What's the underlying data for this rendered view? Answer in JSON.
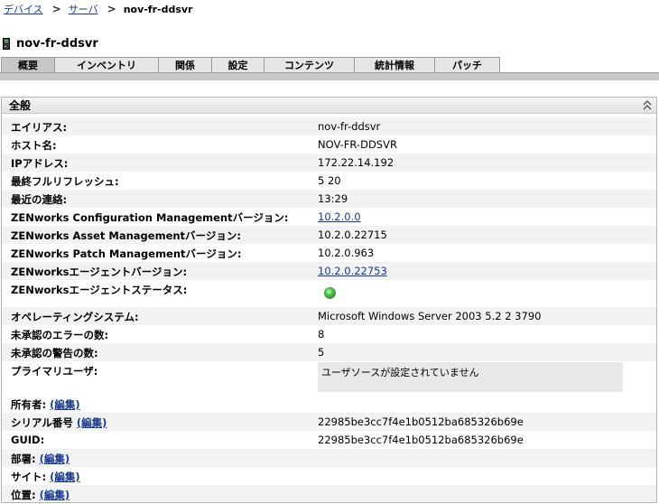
{
  "breadcrumb": {
    "devices": "デバイス",
    "servers": "サーバ",
    "current": "nov-fr-ddsvr",
    "separator": ">"
  },
  "device": {
    "title": "nov-fr-ddsvr",
    "icon": "server-tower-icon"
  },
  "tabs": [
    {
      "label": "概要",
      "active": true
    },
    {
      "label": "インベントリ",
      "active": false
    },
    {
      "label": "関係",
      "active": false
    },
    {
      "label": "設定",
      "active": false
    },
    {
      "label": "コンテンツ",
      "active": false
    },
    {
      "label": "統計情報",
      "active": false
    },
    {
      "label": "パッチ",
      "active": false
    }
  ],
  "panel": {
    "title": "全般",
    "collapse_icon": "double-chevron-up-icon"
  },
  "fields": {
    "alias": {
      "label": "エイリアス:",
      "value": "nov-fr-ddsvr"
    },
    "hostname": {
      "label": "ホスト名:",
      "value": "NOV-FR-DDSVR"
    },
    "ip": {
      "label": "IPアドレス:",
      "value": "172.22.14.192"
    },
    "last_refresh": {
      "label": "最終フルリフレッシュ:",
      "value": "5 20"
    },
    "last_contact": {
      "label": "最近の連絡:",
      "value": "13:29"
    },
    "zcm_version": {
      "label": "ZENworks Configuration Managementバージョン:",
      "value": "10.2.0.0"
    },
    "zam_version": {
      "label": "ZENworks Asset Managementバージョン:",
      "value": "10.2.0.22715"
    },
    "zpm_version": {
      "label": "ZENworks Patch Managementバージョン:",
      "value": "10.2.0.963"
    },
    "agent_version": {
      "label": "ZENworksエージェントバージョン:",
      "value": "10.2.0.22753"
    },
    "agent_status": {
      "label": "ZENworksエージェントステータス:",
      "icon": "status-ok-icon",
      "color": "#3fbf3f"
    },
    "os": {
      "label": "オペレーティングシステム:",
      "value": "Microsoft Windows Server 2003 5.2 2 3790"
    },
    "unack_errors": {
      "label": "未承認のエラーの数:",
      "value": "8"
    },
    "unack_warnings": {
      "label": "未承認の警告の数:",
      "value": "5"
    },
    "primary_user": {
      "label": "プライマリユーザ:",
      "value": "ユーザソースが設定されていません"
    },
    "owner": {
      "label": "所有者:",
      "edit": "(編集)"
    },
    "serial": {
      "label": "シリアル番号",
      "edit": "(編集)",
      "value": "22985be3cc7f4e1b0512ba685326b69e"
    },
    "guid": {
      "label": "GUID:",
      "value": "22985be3cc7f4e1b0512ba685326b69e"
    },
    "department": {
      "label": "部署:",
      "edit": "(編集)"
    },
    "site": {
      "label": "サイト:",
      "edit": "(編集)"
    },
    "location": {
      "label": "位置:",
      "edit": "(編集)"
    }
  }
}
